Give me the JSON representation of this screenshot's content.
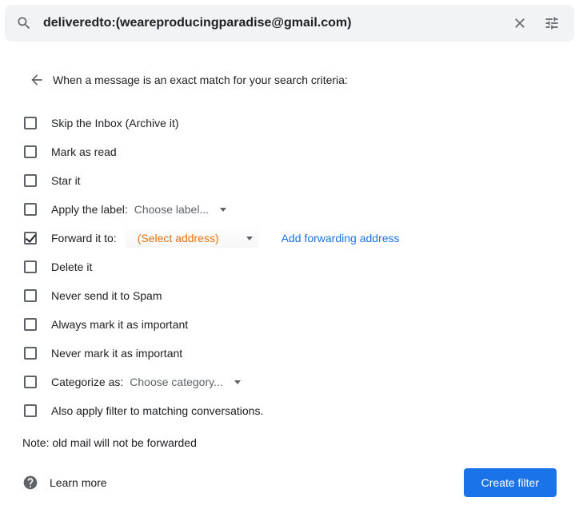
{
  "search": {
    "value": "deliveredto:(weareproducingparadise@gmail.com)"
  },
  "header": "When a message is an exact match for your search criteria:",
  "options": {
    "skip_inbox": "Skip the Inbox (Archive it)",
    "mark_read": "Mark as read",
    "star": "Star it",
    "apply_label": "Apply the label:",
    "apply_label_placeholder": "Choose label...",
    "forward": "Forward it to:",
    "forward_placeholder": "(Select address)",
    "forward_link": "Add forwarding address",
    "delete": "Delete it",
    "never_spam": "Never send it to Spam",
    "always_important": "Always mark it as important",
    "never_important": "Never mark it as important",
    "categorize": "Categorize as:",
    "categorize_placeholder": "Choose category...",
    "also_apply": "Also apply filter to matching conversations."
  },
  "note": "Note: old mail will not be forwarded",
  "learn_more": "Learn more",
  "create_filter": "Create filter"
}
